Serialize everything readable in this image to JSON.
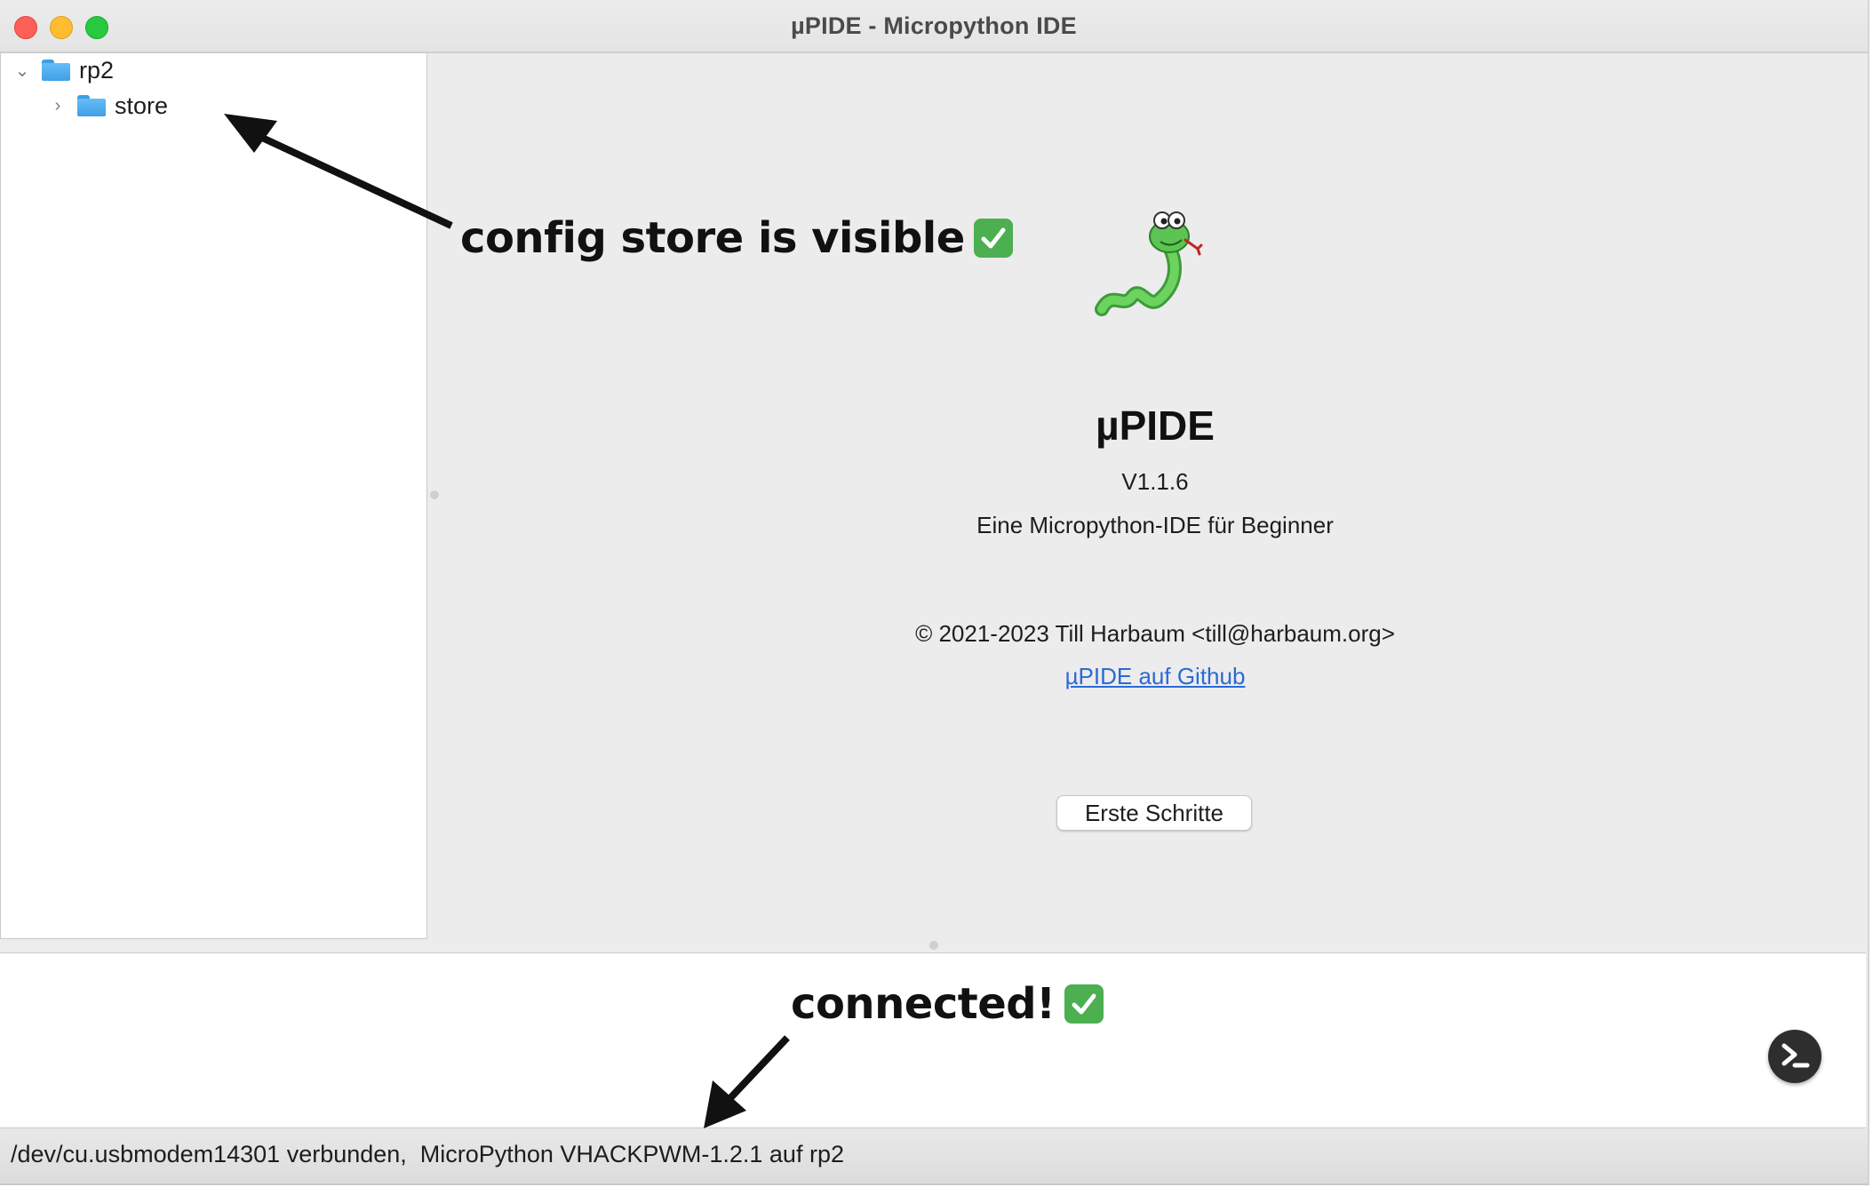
{
  "window": {
    "title": "µPIDE - Micropython IDE"
  },
  "tree": {
    "items": [
      {
        "label": "rp2",
        "expanded": true,
        "icon": "folder-icon"
      },
      {
        "label": "store",
        "expanded": false,
        "icon": "folder-icon"
      }
    ]
  },
  "about": {
    "app_name": "µPIDE",
    "version": "V1.1.6",
    "tagline": "Eine Micropython-IDE für Beginner",
    "copyright": "© 2021-2023 Till Harbaum <till@harbaum.org>",
    "github_link": "µPIDE auf Github",
    "first_steps_button": "Erste Schritte"
  },
  "status": {
    "text": "/dev/cu.usbmodem14301 verbunden,  MicroPython VHACKPWM-1.2.1 auf rp2"
  },
  "annotations": {
    "store_note": "config store is visible",
    "connected_note": "connected!"
  },
  "colors": {
    "accent_link": "#2a6bd4",
    "check_green": "#4caf50",
    "folder_blue": "#3f9fe6"
  }
}
